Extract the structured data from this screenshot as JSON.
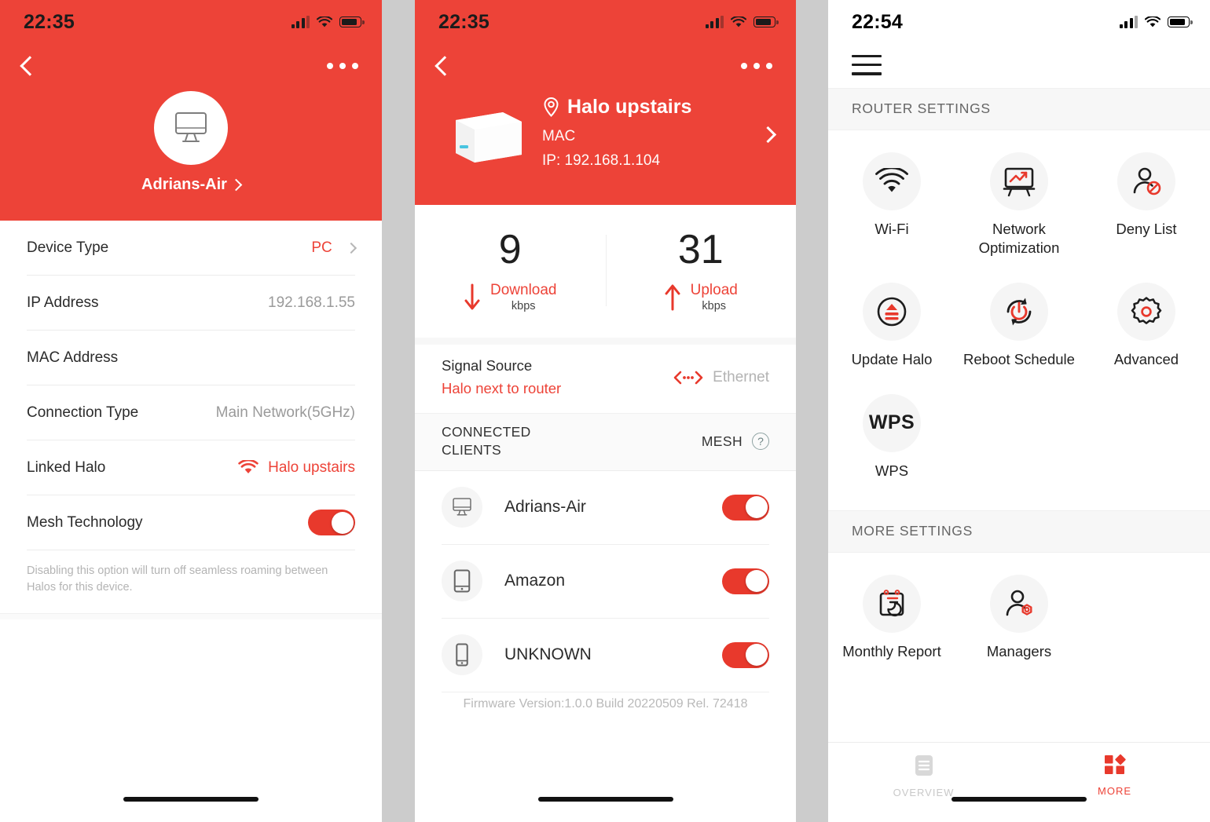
{
  "colors": {
    "brand_red": "#ED4338",
    "toggle_on": "#E8392C",
    "gutter_grey": "#cccccc",
    "section_grey": "#f7f7f7"
  },
  "panel1": {
    "status_bar": {
      "time": "22:35",
      "signal_icon": "cellular-signal-icon",
      "wifi_icon": "wifi-icon",
      "battery_icon": "battery-icon"
    },
    "nav": {
      "back_icon": "chevron-left-icon",
      "more_icon": "more-dots-icon"
    },
    "hero": {
      "avatar_icon": "desktop-monitor-icon",
      "device_name": "Adrians-Air",
      "chevron_icon": "chevron-right-icon"
    },
    "rows": [
      {
        "label": "Device Type",
        "value": "PC",
        "value_style": "accent",
        "has_chevron": true
      },
      {
        "label": "IP Address",
        "value": "192.168.1.55",
        "value_style": "muted",
        "has_chevron": false
      },
      {
        "label": "MAC Address",
        "value": "",
        "value_style": "muted",
        "has_chevron": false
      },
      {
        "label": "Connection Type",
        "value": "Main Network(5GHz)",
        "value_style": "muted",
        "has_chevron": false
      },
      {
        "label": "Linked Halo",
        "value": "Halo upstairs",
        "value_style": "link",
        "has_chevron": false,
        "icon": "wifi-icon"
      },
      {
        "label": "Mesh Technology",
        "value": "",
        "value_style": "toggle",
        "toggle_on": true
      }
    ],
    "note": "Disabling this option will turn off seamless roaming between Halos for this device."
  },
  "panel2": {
    "status_bar": {
      "time": "22:35"
    },
    "nav": {
      "back_icon": "chevron-left-icon",
      "more_icon": "more-dots-icon"
    },
    "hero": {
      "device_image": "halo-router-icon",
      "location_icon": "location-pin-icon",
      "title": "Halo upstairs",
      "mac_line": "MAC",
      "ip_line": "IP: 192.168.1.104",
      "chevron_icon": "chevron-right-icon"
    },
    "speeds": [
      {
        "value": "9",
        "direction_icon": "arrow-down-icon",
        "label": "Download",
        "unit": "kbps"
      },
      {
        "value": "31",
        "direction_icon": "arrow-up-icon",
        "label": "Upload",
        "unit": "kbps"
      }
    ],
    "signal_source": {
      "label": "Signal Source",
      "value": "Halo next to router",
      "connection_icon": "ethernet-icon",
      "connection_label": "Ethernet"
    },
    "clients_header": {
      "title": "CONNECTED CLIENTS",
      "mesh_label": "MESH",
      "help_icon": "question-mark-icon"
    },
    "clients": [
      {
        "name": "Adrians-Air",
        "icon": "desktop-monitor-icon",
        "toggle_on": true
      },
      {
        "name": "Amazon",
        "icon": "tablet-icon",
        "toggle_on": true
      },
      {
        "name": "UNKNOWN",
        "icon": "smartphone-icon",
        "toggle_on": true
      }
    ],
    "firmware": "Firmware Version:1.0.0 Build 20220509 Rel. 72418"
  },
  "panel3": {
    "status_bar": {
      "time": "22:54"
    },
    "nav": {
      "menu_icon": "hamburger-menu-icon"
    },
    "sections": [
      {
        "title": "ROUTER SETTINGS",
        "items": [
          {
            "label": "Wi-Fi",
            "icon": "wifi-icon"
          },
          {
            "label": "Network Optimization",
            "icon": "network-optimization-icon"
          },
          {
            "label": "Deny List",
            "icon": "user-blocked-icon"
          },
          {
            "label": "Update Halo",
            "icon": "firmware-upload-icon"
          },
          {
            "label": "Reboot Schedule",
            "icon": "reboot-power-icon"
          },
          {
            "label": "Advanced",
            "icon": "gear-icon"
          },
          {
            "label": "WPS",
            "icon": "wps-text-icon",
            "icon_text": "WPS"
          }
        ]
      },
      {
        "title": "MORE SETTINGS",
        "items": [
          {
            "label": "Monthly Report",
            "icon": "calendar-report-icon"
          },
          {
            "label": "Managers",
            "icon": "user-settings-icon"
          }
        ]
      }
    ],
    "tabs": [
      {
        "label": "OVERVIEW",
        "icon": "document-list-icon",
        "active": false
      },
      {
        "label": "MORE",
        "icon": "grid-squares-icon",
        "active": true
      }
    ]
  }
}
